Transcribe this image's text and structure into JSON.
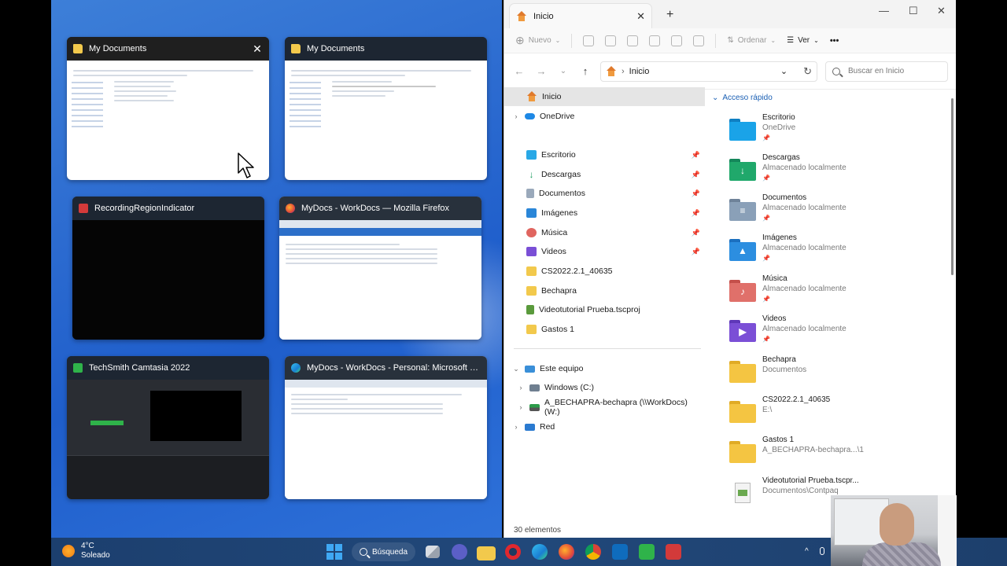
{
  "snap_assist": {
    "windows": [
      {
        "title": "My Documents",
        "icon": "folder-icon",
        "close": "✕"
      },
      {
        "title": "My Documents",
        "icon": "folder-icon"
      },
      {
        "title": "RecordingRegionIndicator",
        "icon": "camtasia-recorder-icon"
      },
      {
        "title": "MyDocs - WorkDocs — Mozilla Firefox",
        "icon": "firefox-icon"
      },
      {
        "title": "TechSmith Camtasia 2022",
        "icon": "camtasia-icon"
      },
      {
        "title": "MyDocs - WorkDocs - Personal: Microsoft Edge",
        "icon": "edge-icon"
      }
    ]
  },
  "explorer": {
    "tab_title": "Inicio",
    "tab_close": "✕",
    "new_tab": "+",
    "window_controls": {
      "minimize": "—",
      "maximize": "☐",
      "close": "✕"
    },
    "toolbar": {
      "new": "Nuevo",
      "sort": "Ordenar",
      "view": "Ver",
      "more": "•••"
    },
    "address": {
      "back": "←",
      "forward": "→",
      "recent": "⌄",
      "up": "↑",
      "location": "Inicio",
      "dropdown": "⌄",
      "refresh": "↻"
    },
    "search_placeholder": "Buscar en Inicio",
    "nav": {
      "items": [
        {
          "label": "Inicio",
          "icon": "home-icon",
          "selected": true
        },
        {
          "label": "OneDrive",
          "icon": "onedrive-icon",
          "chevron": "›"
        },
        {
          "label": "Escritorio",
          "icon": "desktop-icon",
          "pinned": true
        },
        {
          "label": "Descargas",
          "icon": "download-icon",
          "pinned": true
        },
        {
          "label": "Documentos",
          "icon": "documents-icon",
          "pinned": true
        },
        {
          "label": "Imágenes",
          "icon": "pictures-icon",
          "pinned": true
        },
        {
          "label": "Música",
          "icon": "music-icon",
          "pinned": true
        },
        {
          "label": "Videos",
          "icon": "videos-icon",
          "pinned": true
        },
        {
          "label": "CS2022.2.1_40635",
          "icon": "folder-icon"
        },
        {
          "label": "Bechapra",
          "icon": "folder-icon"
        },
        {
          "label": "Videotutorial Prueba.tscproj",
          "icon": "camtasia-file-icon"
        },
        {
          "label": "Gastos 1",
          "icon": "folder-icon"
        },
        {
          "label": "Este equipo",
          "icon": "computer-icon",
          "chevron": "⌄"
        },
        {
          "label": "Windows (C:)",
          "icon": "drive-icon",
          "chevron": "›"
        },
        {
          "label": "A_BECHAPRA-bechapra (\\\\WorkDocs) (W:)",
          "icon": "network-drive-icon",
          "chevron": "›"
        },
        {
          "label": "Red",
          "icon": "network-icon",
          "chevron": "›"
        }
      ],
      "pin_glyph": "📌"
    },
    "quick_access": {
      "header": "Acceso rápido",
      "items": [
        {
          "name": "Escritorio",
          "sub": "OneDrive",
          "color": "#1aa3e8",
          "pinned": true
        },
        {
          "name": "Descargas",
          "sub": "Almacenado localmente",
          "color": "#20a86b",
          "glyph": "↓",
          "pinned": true
        },
        {
          "name": "Documentos",
          "sub": "Almacenado localmente",
          "color": "#8aa0b8",
          "glyph": "≡",
          "pinned": true
        },
        {
          "name": "Imágenes",
          "sub": "Almacenado localmente",
          "color": "#2c8ee0",
          "glyph": "▲",
          "pinned": true
        },
        {
          "name": "Música",
          "sub": "Almacenado localmente",
          "color": "#e0706a",
          "glyph": "♪",
          "pinned": true
        },
        {
          "name": "Videos",
          "sub": "Almacenado localmente",
          "color": "#7b4fd6",
          "glyph": "▶",
          "pinned": true
        },
        {
          "name": "Bechapra",
          "sub": "Documentos",
          "color": "#f4c542"
        },
        {
          "name": "CS2022.2.1_40635",
          "sub": "E:\\",
          "color": "#f4c542"
        },
        {
          "name": "Gastos 1",
          "sub": "A_BECHAPRA-bechapra...\\1",
          "color": "#f4c542"
        },
        {
          "name": "Videotutorial Prueba.tscpr...",
          "sub": "Documentos\\Contpaq",
          "file": true
        }
      ]
    },
    "status": "30 elementos"
  },
  "taskbar": {
    "weather_temp": "4°C",
    "weather_desc": "Soleado",
    "search_label": "Búsqueda",
    "tray": {
      "up": "^"
    }
  }
}
